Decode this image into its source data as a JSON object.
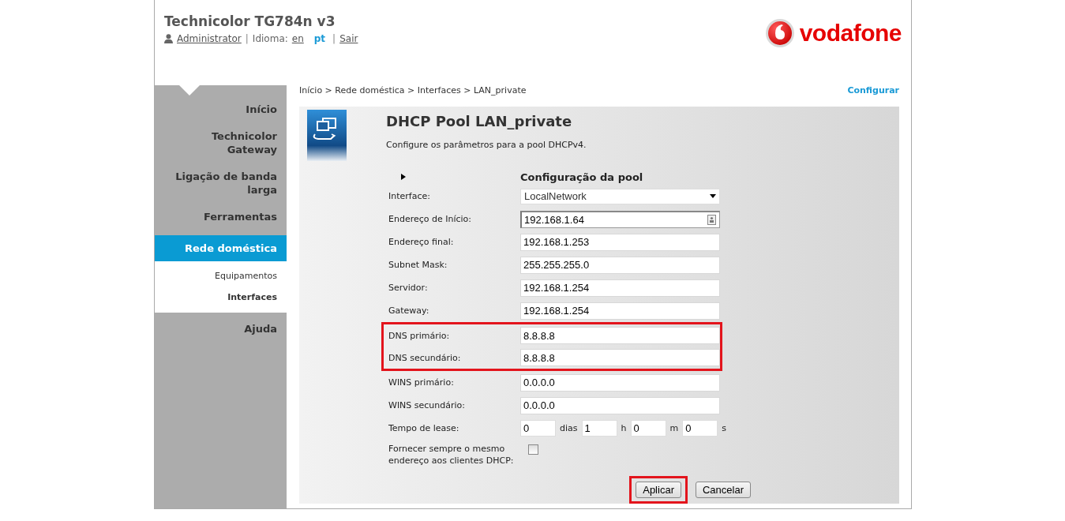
{
  "header": {
    "title": "Technicolor TG784n v3",
    "user": "Administrator",
    "separator": "|",
    "language_label": "Idioma:",
    "languages": [
      {
        "label": "en",
        "selected": false
      },
      {
        "label": "pt",
        "selected": true
      }
    ],
    "logout": "Sair",
    "logo_text": "vodafone"
  },
  "sidebar": {
    "items": [
      {
        "label": "Início",
        "selected": false
      },
      {
        "label": "Technicolor Gateway",
        "selected": false
      },
      {
        "label": "Ligação de banda larga",
        "selected": false
      },
      {
        "label": "Ferramentas",
        "selected": false
      },
      {
        "label": "Rede doméstica",
        "selected": true,
        "children": [
          {
            "label": "Equipamentos",
            "selected": false
          },
          {
            "label": "Interfaces",
            "selected": true
          }
        ]
      },
      {
        "label": "Ajuda",
        "selected": false
      }
    ]
  },
  "breadcrumb": "Início > Rede doméstica > Interfaces > LAN_private",
  "mode_link": "Configurar",
  "panel": {
    "title": "DHCP Pool LAN_private",
    "description": "Configure os parâmetros para a pool DHCPv4.",
    "section_title": "Configuração da pool",
    "fields": [
      {
        "kind": "select",
        "label": "Interface:",
        "value": "LocalNetwork",
        "highlighted": false
      },
      {
        "kind": "text",
        "label": "Endereço de Início:",
        "value": "192.168.1.64",
        "focused": true,
        "highlighted": false
      },
      {
        "kind": "text",
        "label": "Endereço final:",
        "value": "192.168.1.253",
        "focused": false,
        "highlighted": false
      },
      {
        "kind": "text",
        "label": "Subnet Mask:",
        "value": "255.255.255.0",
        "focused": false,
        "highlighted": false
      },
      {
        "kind": "text",
        "label": "Servidor:",
        "value": "192.168.1.254",
        "focused": false,
        "highlighted": false
      },
      {
        "kind": "text",
        "label": "Gateway:",
        "value": "192.168.1.254",
        "focused": false,
        "highlighted": false
      },
      {
        "kind": "text",
        "label": "DNS primário:",
        "value": "8.8.8.8",
        "focused": false,
        "highlighted": true
      },
      {
        "kind": "text",
        "label": "DNS secundário:",
        "value": "8.8.8.8",
        "focused": false,
        "highlighted": true
      },
      {
        "kind": "text",
        "label": "WINS primário:",
        "value": "0.0.0.0",
        "focused": false,
        "highlighted": false
      },
      {
        "kind": "text",
        "label": "WINS secundário:",
        "value": "0.0.0.0",
        "focused": false,
        "highlighted": false
      },
      {
        "kind": "lease",
        "label": "Tempo de lease:",
        "highlighted": false,
        "parts": [
          {
            "value": "0",
            "unit": "dias"
          },
          {
            "value": "1",
            "unit": "h"
          },
          {
            "value": "0",
            "unit": "m"
          },
          {
            "value": "0",
            "unit": "s"
          }
        ]
      },
      {
        "kind": "checkbox",
        "label": "Fornecer sempre o mesmo endereço aos clientes DHCP:",
        "checked": false,
        "highlighted": false
      }
    ],
    "buttons": [
      {
        "label": "Aplicar",
        "highlighted": true
      },
      {
        "label": "Cancelar",
        "highlighted": false
      }
    ]
  }
}
